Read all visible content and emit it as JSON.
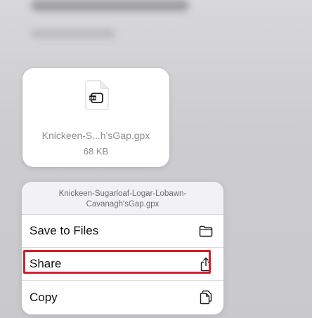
{
  "file_card": {
    "file_name": "Knickeen-S...h'sGap.gpx",
    "file_size": "68 KB",
    "icon_label": "GPX",
    "icon": "gpx-document-icon"
  },
  "menu": {
    "header": "Knickeen-Sugarloaf-Logar-Lobawn-Cavanagh'sGap.gpx",
    "items": [
      {
        "label": "Save to Files",
        "icon": "folder-icon"
      },
      {
        "label": "Share",
        "icon": "share-icon",
        "highlighted": true
      },
      {
        "label": "Copy",
        "icon": "copy-icon"
      }
    ]
  },
  "colors": {
    "highlight": "#d21f2a",
    "menu_background": "#f2f2f4",
    "card_background": "#ffffff",
    "secondary_text": "#8e8e93"
  }
}
